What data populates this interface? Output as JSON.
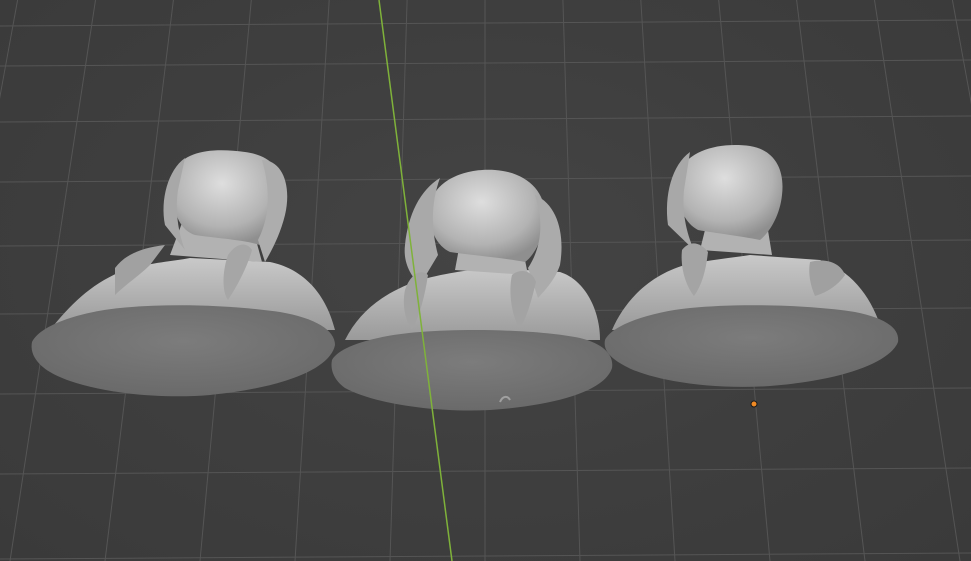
{
  "viewport": {
    "background": "#3d3d3d",
    "grid_color": "#555555",
    "y_axis_color": "#7fb23a",
    "origin_marker_color": "#f08a24"
  },
  "objects": [
    {
      "name": "bust-left",
      "color": "#8c8c8c"
    },
    {
      "name": "bust-center",
      "color": "#8c8c8c"
    },
    {
      "name": "bust-right",
      "color": "#8c8c8c"
    }
  ]
}
